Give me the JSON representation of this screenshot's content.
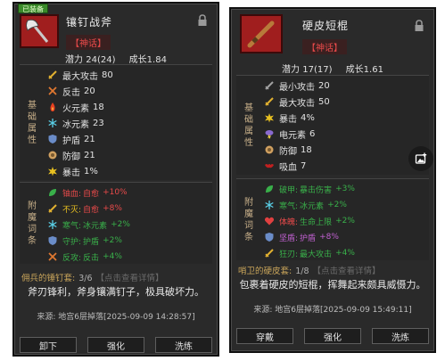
{
  "colors": {
    "panel_bg": "#2a2a2a",
    "rarity_red": "#e84a4a",
    "enchant_green": "#39b04a",
    "set_gold": "#c8a45a"
  },
  "panels": [
    {
      "equipped_tag": "已装备",
      "name": "镶钉战斧",
      "rarity": "【神话】",
      "icon": "battle-axe-icon",
      "potential": "潜力 24(24)",
      "growth": "成长1.84",
      "base_label": "基础属性",
      "base_stats": [
        {
          "icon": "sword-icon",
          "color": "#e0b030",
          "label": "最大攻击",
          "value": "80"
        },
        {
          "icon": "crossed-swords-icon",
          "color": "#e07830",
          "label": "反击",
          "value": "20"
        },
        {
          "icon": "fire-icon",
          "color": "#e84020",
          "label": "火元素",
          "value": "18"
        },
        {
          "icon": "snowflake-icon",
          "color": "#5ad0e8",
          "label": "冰元素",
          "value": "23"
        },
        {
          "icon": "shield-icon",
          "color": "#6a8cc8",
          "label": "护盾",
          "value": "21"
        },
        {
          "icon": "defense-icon",
          "color": "#d0a060",
          "label": "防御",
          "value": "21"
        },
        {
          "icon": "burst-icon",
          "color": "#e8c020",
          "label": "暴击",
          "value": "1%"
        }
      ],
      "ench_label": "附魔词条",
      "enchants": [
        {
          "icon": "leaf-icon",
          "color": "#39b04a",
          "name": "铀血:",
          "name_color": "#e84a4a",
          "desc": "自愈",
          "desc_color": "#e84a4a",
          "value": "+10%",
          "value_color": "#e84a4a"
        },
        {
          "icon": "sword-icon",
          "color": "#e0b030",
          "name": "不灭:",
          "name_color": "#e8c020",
          "desc": "自愈",
          "desc_color": "#e84a4a",
          "value": "+8%",
          "value_color": "#e84a4a"
        },
        {
          "icon": "snowflake-icon",
          "color": "#5ad0e8",
          "name": "寒气:",
          "name_color": "#39b04a",
          "desc": "冰元素",
          "desc_color": "#39b04a",
          "value": "+2%",
          "value_color": "#39b04a"
        },
        {
          "icon": "shield-icon",
          "color": "#6a8cc8",
          "name": "守护:",
          "name_color": "#39b04a",
          "desc": "护盾",
          "desc_color": "#39b04a",
          "value": "+2%",
          "value_color": "#39b04a"
        },
        {
          "icon": "crossed-swords-icon",
          "color": "#e07830",
          "name": "反攻:",
          "name_color": "#39b04a",
          "desc": "反击",
          "desc_color": "#39b04a",
          "value": "+4%",
          "value_color": "#39b04a"
        }
      ],
      "set_name": "佣兵的锤钉套:",
      "set_count": "3/6",
      "set_link": "【点击查看详情】",
      "flavor": "斧刃锋利，斧身镶满钉子，极具破坏力。",
      "source": "来源: 地宫6层掉落[2025-09-09 14:28:57]",
      "buttons": [
        "卸下",
        "强化",
        "洗练"
      ]
    },
    {
      "name": "硬皮短棍",
      "rarity": "【神话】",
      "icon": "club-icon",
      "potential": "潜力 17(17)",
      "growth": "成长1.61",
      "base_label": "基础属性",
      "base_stats": [
        {
          "icon": "sword-icon",
          "color": "#a0a0a0",
          "label": "最小攻击",
          "value": "20"
        },
        {
          "icon": "sword-icon",
          "color": "#e0b030",
          "label": "最大攻击",
          "value": "50"
        },
        {
          "icon": "burst-icon",
          "color": "#e8c020",
          "label": "暴击",
          "value": "4%"
        },
        {
          "icon": "cloud-icon",
          "color": "#8a6ad0",
          "label": "电元素",
          "value": "6"
        },
        {
          "icon": "defense-icon",
          "color": "#d0a060",
          "label": "防御",
          "value": "18"
        },
        {
          "icon": "bat-icon",
          "color": "#c02020",
          "label": "吸血",
          "value": "7"
        }
      ],
      "ench_label": "附魔词条",
      "enchants": [
        {
          "icon": "leaf-icon",
          "color": "#39b04a",
          "name": "破甲:",
          "name_color": "#39b04a",
          "desc": "暴击伤害",
          "desc_color": "#39b04a",
          "value": "+3%",
          "value_color": "#39b04a"
        },
        {
          "icon": "snowflake-icon",
          "color": "#5ad0e8",
          "name": "寒气:",
          "name_color": "#39b04a",
          "desc": "冰元素",
          "desc_color": "#39b04a",
          "value": "+2%",
          "value_color": "#39b04a"
        },
        {
          "icon": "heart-icon",
          "color": "#e04040",
          "name": "体魄:",
          "name_color": "#e84a4a",
          "desc": "生命上限",
          "desc_color": "#39b04a",
          "value": "+2%",
          "value_color": "#39b04a"
        },
        {
          "icon": "shield-icon",
          "color": "#6a8cc8",
          "name": "坚盾:",
          "name_color": "#c060d0",
          "desc": "护盾",
          "desc_color": "#c060d0",
          "value": "+8%",
          "value_color": "#c060d0"
        },
        {
          "icon": "sword-icon",
          "color": "#e0b030",
          "name": "狂刃:",
          "name_color": "#39b04a",
          "desc": "最大攻击",
          "desc_color": "#39b04a",
          "value": "+4%",
          "value_color": "#39b04a"
        }
      ],
      "set_name": "哨卫的硬皮套:",
      "set_count": "1/8",
      "set_link": "【点击查看详情】",
      "flavor": "包裹着硬皮的短棍，挥舞起来颇具威慑力。",
      "source": "来源: 地宫6层掉落[2025-09-09 15:49:11]",
      "buttons": [
        "穿戴",
        "强化",
        "洗炼"
      ]
    }
  ]
}
